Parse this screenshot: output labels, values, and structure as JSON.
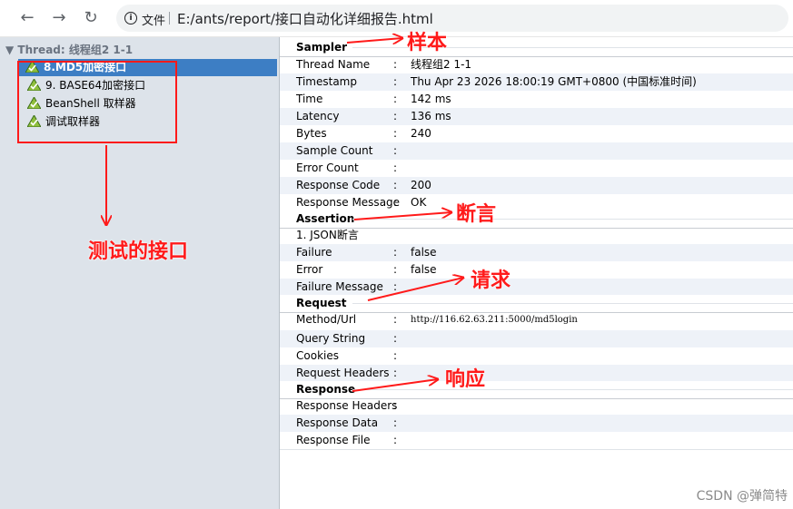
{
  "browser": {
    "file_label": "文件",
    "url": "E:/ants/report/接口自动化详细报告.html"
  },
  "tree": {
    "header": "Thread: 线程组2 1-1",
    "items": [
      {
        "label": "8.MD5加密接口",
        "selected": true
      },
      {
        "label": "9. BASE64加密接口",
        "selected": false
      },
      {
        "label": "BeanShell 取样器",
        "selected": false
      },
      {
        "label": "调试取样器",
        "selected": false
      }
    ]
  },
  "details": {
    "sampler": {
      "title": "Sampler",
      "rows": [
        {
          "key": "Thread Name",
          "sep": ":",
          "value": "线程组2 1-1"
        },
        {
          "key": "Timestamp",
          "sep": ":",
          "value": "Thu Apr 23 2026 18:00:19 GMT+0800 (中国标准时间)"
        },
        {
          "key": "Time",
          "sep": ":",
          "value": "142 ms"
        },
        {
          "key": "Latency",
          "sep": ":",
          "value": "136 ms"
        },
        {
          "key": "Bytes",
          "sep": ":",
          "value": "240"
        },
        {
          "key": "Sample Count",
          "sep": ":",
          "value": ""
        },
        {
          "key": "Error Count",
          "sep": ":",
          "value": ""
        },
        {
          "key": "Response Code",
          "sep": ":",
          "value": "200"
        },
        {
          "key": "Response Message",
          "sep": ":",
          "value": "OK"
        }
      ]
    },
    "assertion": {
      "title": "Assertion",
      "name": "1. JSON断言",
      "rows": [
        {
          "key": "Failure",
          "sep": ":",
          "value": "false"
        },
        {
          "key": "Error",
          "sep": ":",
          "value": "false"
        },
        {
          "key": "Failure Message",
          "sep": ":",
          "value": ""
        }
      ]
    },
    "request": {
      "title": "Request",
      "rows": [
        {
          "key": "Method/Url",
          "sep": ":",
          "value": "http://116.62.63.211:5000/md5login"
        },
        {
          "key": "Query String",
          "sep": ":",
          "value": ""
        },
        {
          "key": "Cookies",
          "sep": ":",
          "value": ""
        },
        {
          "key": "Request Headers",
          "sep": ":",
          "value": ""
        }
      ]
    },
    "response": {
      "title": "Response",
      "rows": [
        {
          "key": "Response Headers",
          "sep": ":",
          "value": ""
        },
        {
          "key": "Response Data",
          "sep": ":",
          "value": ""
        },
        {
          "key": "Response File",
          "sep": ":",
          "value": ""
        }
      ]
    }
  },
  "annotations": {
    "sample": "样本",
    "assertion": "断言",
    "request": "请求",
    "response": "响应",
    "tested_interfaces": "测试的接口",
    "color": "#ff1a1a"
  },
  "watermark": "CSDN @弹简特"
}
